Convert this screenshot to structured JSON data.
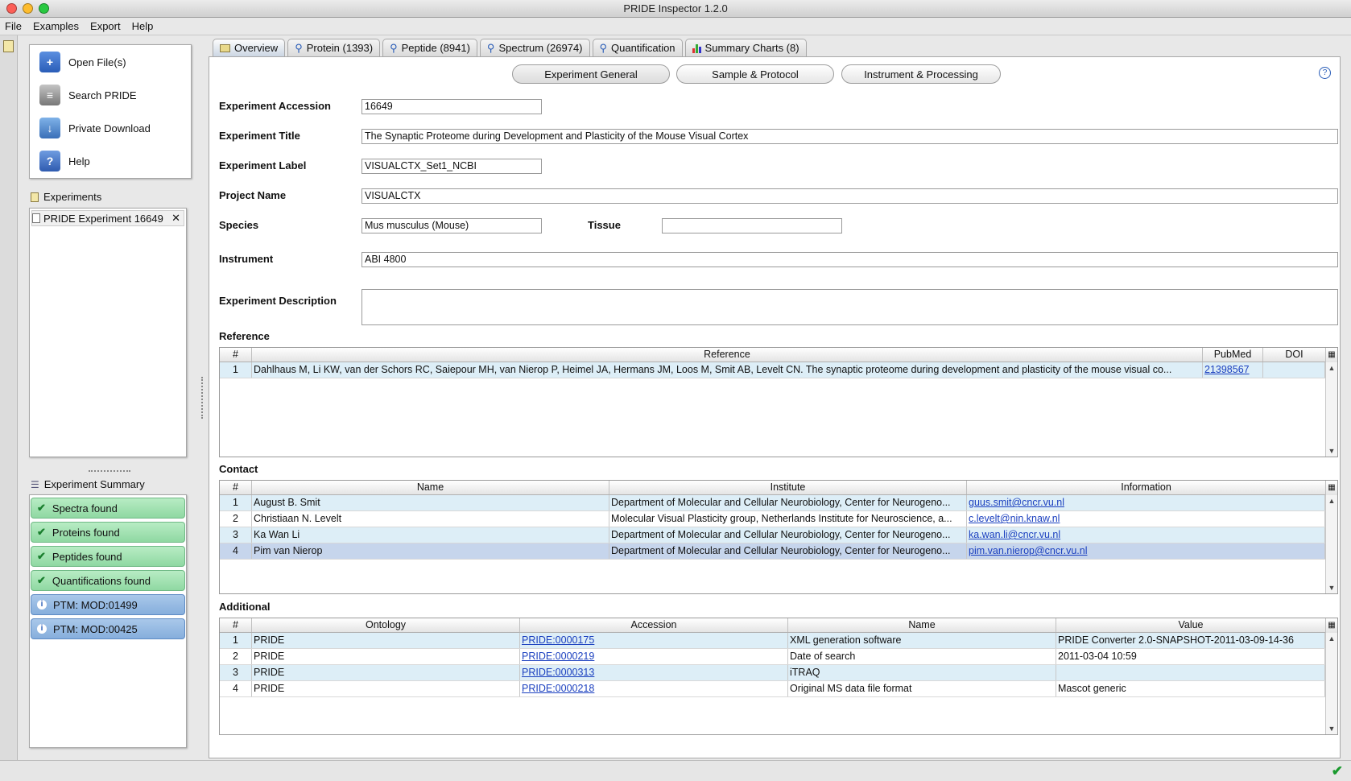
{
  "window": {
    "title": "PRIDE Inspector 1.2.0"
  },
  "menu": [
    "File",
    "Examples",
    "Export",
    "Help"
  ],
  "actions": [
    {
      "label": "Open File(s)",
      "icon": "open-file-icon"
    },
    {
      "label": "Search PRIDE",
      "icon": "database-search-icon"
    },
    {
      "label": "Private Download",
      "icon": "download-icon"
    },
    {
      "label": "Help",
      "icon": "help-book-icon"
    }
  ],
  "experiments": {
    "header": "Experiments",
    "items": [
      "PRIDE Experiment 16649"
    ]
  },
  "summary": {
    "header": "Experiment Summary",
    "items": [
      {
        "label": "Spectra found",
        "status": "ok"
      },
      {
        "label": "Proteins found",
        "status": "ok"
      },
      {
        "label": "Peptides found",
        "status": "ok"
      },
      {
        "label": "Quantifications found",
        "status": "ok"
      },
      {
        "label": "PTM: MOD:01499",
        "status": "info"
      },
      {
        "label": "PTM: MOD:00425",
        "status": "info"
      }
    ]
  },
  "tabs": [
    {
      "label": "Overview",
      "icon": "overview-icon"
    },
    {
      "label": "Protein (1393)",
      "icon": "magnifier-icon"
    },
    {
      "label": "Peptide (8941)",
      "icon": "magnifier-icon"
    },
    {
      "label": "Spectrum (26974)",
      "icon": "magnifier-icon"
    },
    {
      "label": "Quantification",
      "icon": "magnifier-icon"
    },
    {
      "label": "Summary Charts (8)",
      "icon": "bar-chart-icon"
    }
  ],
  "subtabs": [
    "Experiment General",
    "Sample & Protocol",
    "Instrument & Processing"
  ],
  "form": {
    "accession_label": "Experiment Accession",
    "accession": "16649",
    "title_label": "Experiment Title",
    "title": "The Synaptic Proteome during Development and Plasticity of the Mouse Visual Cortex",
    "exp_label_label": "Experiment Label",
    "exp_label": "VISUALCTX_Set1_NCBI",
    "project_label": "Project Name",
    "project": "VISUALCTX",
    "species_label": "Species",
    "species": "Mus musculus (Mouse)",
    "tissue_label": "Tissue",
    "tissue": "",
    "instrument_label": "Instrument",
    "instrument": "ABI 4800",
    "description_label": "Experiment Description",
    "description": ""
  },
  "reference": {
    "title": "Reference",
    "columns": [
      "#",
      "Reference",
      "PubMed",
      "DOI"
    ],
    "rows": [
      [
        "1",
        "Dahlhaus M, Li KW, van der Schors RC, Saiepour MH, van Nierop P, Heimel JA, Hermans JM, Loos M, Smit AB, Levelt CN. The synaptic proteome during development  and plasticity of the mouse visual co...",
        "21398567",
        ""
      ]
    ]
  },
  "contact": {
    "title": "Contact",
    "columns": [
      "#",
      "Name",
      "Institute",
      "Information"
    ],
    "rows": [
      [
        "1",
        "August B. Smit",
        "Department of Molecular and Cellular Neurobiology, Center for Neurogeno...",
        "guus.smit@cncr.vu.nl"
      ],
      [
        "2",
        "Christiaan N. Levelt",
        "Molecular Visual Plasticity group, Netherlands Institute for Neuroscience, a...",
        "c.levelt@nin.knaw.nl"
      ],
      [
        "3",
        "Ka Wan Li",
        "Department of Molecular and Cellular Neurobiology, Center for Neurogeno...",
        "ka.wan.li@cncr.vu.nl"
      ],
      [
        "4",
        "Pim van Nierop",
        "Department of Molecular and Cellular Neurobiology, Center for Neurogeno...",
        "pim.van.nierop@cncr.vu.nl"
      ]
    ]
  },
  "additional": {
    "title": "Additional",
    "columns": [
      "#",
      "Ontology",
      "Accession",
      "Name",
      "Value"
    ],
    "rows": [
      [
        "1",
        "PRIDE",
        "PRIDE:0000175",
        "XML generation software",
        "PRIDE Converter 2.0-SNAPSHOT-2011-03-09-14-36"
      ],
      [
        "2",
        "PRIDE",
        "PRIDE:0000219",
        "Date of search",
        "2011-03-04 10:59"
      ],
      [
        "3",
        "PRIDE",
        "PRIDE:0000313",
        "iTRAQ",
        ""
      ],
      [
        "4",
        "PRIDE",
        "PRIDE:0000218",
        "Original MS data file format",
        "Mascot generic"
      ]
    ]
  },
  "colors": {
    "accent": "#1a3fbf",
    "row_highlight": "#ddeef7",
    "row_selected": "#c6d5ec",
    "ok": "#8fd8a2",
    "info": "#86aedc"
  }
}
